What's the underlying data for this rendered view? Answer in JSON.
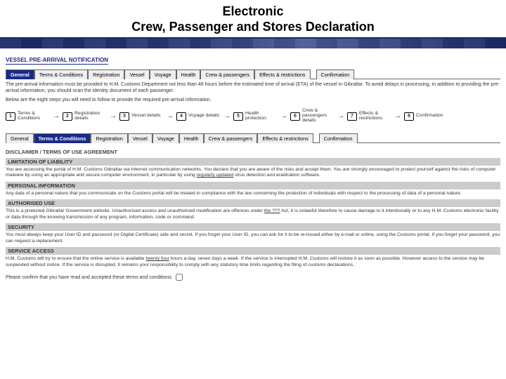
{
  "header": {
    "title_line1": "Electronic",
    "title_line2": "Crew, Passenger and Stores Declaration"
  },
  "sectionA_title": "VESSEL PRE-ARRIVAL NOTIFICATION",
  "tabs_a": [
    "General",
    "Terms & Conditions",
    "Registration",
    "Vessel",
    "Voyage",
    "Health",
    "Crew & passengers",
    "Effects & restrictions",
    "Confirmation"
  ],
  "tabs_a_active": 0,
  "intro1": "The pre-arrival information must be provided to H.M. Customs Department not less than 48 hours before the estimated time of arrival (ETA) of the vessel in Gibraltar. To avoid delays in processing, in addition to providing the pre-arrival information, you should scan the identity document of each passenger.",
  "intro2": "Below are the eight steps you will need to follow to provide the required pre-arrival information.",
  "steps": [
    {
      "n": "1",
      "label": "Terms & Conditions"
    },
    {
      "n": "2",
      "label": "Registration details"
    },
    {
      "n": "3",
      "label": "Vessel details"
    },
    {
      "n": "4",
      "label": "Voyage details"
    },
    {
      "n": "5",
      "label": "Health protection"
    },
    {
      "n": "6",
      "label": "Crew & passengers details"
    },
    {
      "n": "7",
      "label": "Effects & restrictions"
    },
    {
      "n": "8",
      "label": "Confirmation"
    }
  ],
  "tabs_b": [
    "General",
    "Terms & Conditions",
    "Registration",
    "Vessel",
    "Voyage",
    "Health",
    "Crew & passengers",
    "Effects & restrictions",
    "Confirmation"
  ],
  "tabs_b_active": 1,
  "disclaimer_title": "DISCLAIMER / TERMS OF USE AGREEMENT",
  "tc": [
    {
      "head": "LIMITATION OF LIABILITY",
      "body_pre": "You are accessing the portal of H.M. Customs Gibraltar via Internet communication networks. You declare that you are aware of the risks and accept them. You are strongly encouraged to protect yourself against the risks of computer malware by using an appropriate and secure computer environment, in particular by using ",
      "link": "regularly updated",
      "body_post": " virus detection and eradication software."
    },
    {
      "head": "PERSONAL INFORMATION",
      "body_pre": "Any data of a personal nature that you communicate on the Customs portal will be treated in compliance with the law concerning the protection of individuals with respect to the processing of data of a personal nature.",
      "link": "",
      "body_post": ""
    },
    {
      "head": "AUTHORISED USE",
      "body_pre": "This is a protected Gibraltar Government website. Unauthorised access and unauthorised modification are offences under ",
      "link": "the ???",
      "body_post": " Act; it is unlawful therefore to cause damage to it intentionally or to any H.M. Customs electronic facility or data through the knowing transmission of any program, information, code or command."
    },
    {
      "head": "SECURITY",
      "body_pre": "You must always keep your User ID and password (or Digital Certificate) safe and secret. If you forget your User ID, you can ask for it to be re-issued either by e-mail or online, using the Customs portal. If you forget your password, you can request a replacement.",
      "link": "",
      "body_post": ""
    },
    {
      "head": "SERVICE ACCESS",
      "body_pre": "H.M. Customs will try to ensure that the online service is available ",
      "link": "twenty four",
      "body_post": " hours a day, seven days a week. If the service is interrupted H.M. Customs will restore it as soon as possible. However access to the service may be suspended without notice. If the service is disrupted, it remains your responsibility to comply with any statutory time limits regarding the filing of customs declarations."
    }
  ],
  "confirm_text": "Please confirm that you have read and accepted these terms and conditions:"
}
